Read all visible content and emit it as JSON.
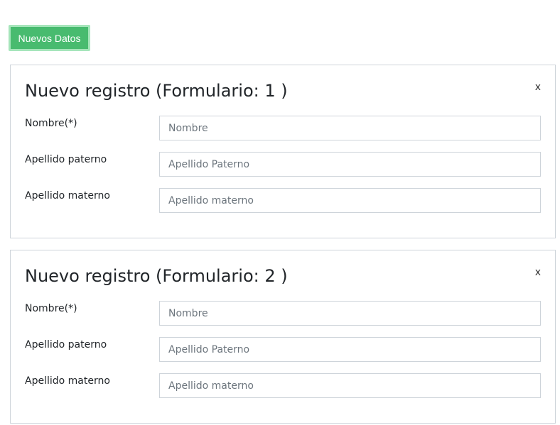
{
  "toolbar": {
    "new_data_label": "Nuevos Datos"
  },
  "forms": [
    {
      "title": "Nuevo registro (Formulario: 1 )",
      "close_label": "x",
      "fields": [
        {
          "label": "Nombre(*)",
          "placeholder": "Nombre",
          "value": ""
        },
        {
          "label": "Apellido paterno",
          "placeholder": "Apellido Paterno",
          "value": ""
        },
        {
          "label": "Apellido materno",
          "placeholder": "Apellido materno",
          "value": ""
        }
      ]
    },
    {
      "title": "Nuevo registro (Formulario: 2 )",
      "close_label": "x",
      "fields": [
        {
          "label": "Nombre(*)",
          "placeholder": "Nombre",
          "value": ""
        },
        {
          "label": "Apellido paterno",
          "placeholder": "Apellido Paterno",
          "value": ""
        },
        {
          "label": "Apellido materno",
          "placeholder": "Apellido materno",
          "value": ""
        }
      ]
    }
  ],
  "colors": {
    "primary_button": "#48bb6f",
    "primary_button_focus_ring": "#a6e5bb",
    "border": "#ced4da"
  }
}
